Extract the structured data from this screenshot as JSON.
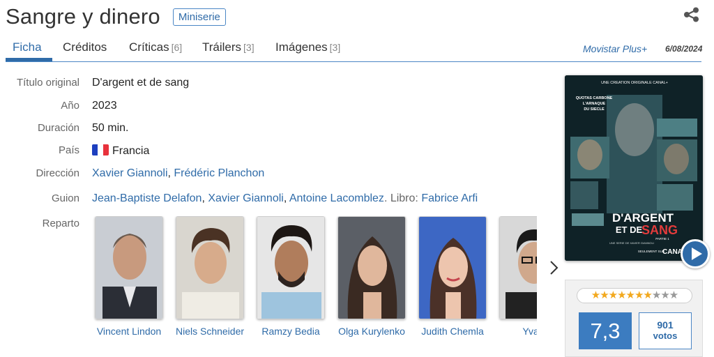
{
  "header": {
    "title": "Sangre y dinero",
    "type_badge": "Miniserie"
  },
  "icons": {
    "share": "share-icon",
    "next": "chevron-right-icon",
    "play": "play-icon",
    "flag": "france-flag-icon"
  },
  "tabs": [
    {
      "label": "Ficha",
      "count": ""
    },
    {
      "label": "Créditos",
      "count": ""
    },
    {
      "label": "Críticas",
      "count": "[6]"
    },
    {
      "label": "Tráilers",
      "count": "[3]"
    },
    {
      "label": "Imágenes",
      "count": "[3]"
    }
  ],
  "release": {
    "platform": "Movistar Plus+",
    "date": "6/08/2024"
  },
  "info": {
    "original_title": {
      "label": "Título original",
      "value": "D'argent et de sang"
    },
    "year": {
      "label": "Año",
      "value": "2023"
    },
    "duration": {
      "label": "Duración",
      "value": "50 min."
    },
    "country": {
      "label": "País",
      "value": "Francia"
    },
    "direction": {
      "label": "Dirección",
      "names": [
        "Xavier Giannoli",
        "Frédéric Planchon"
      ]
    },
    "script": {
      "label": "Guion",
      "names": [
        "Jean-Baptiste Delafon",
        "Xavier Giannoli",
        "Antoine Lacomblez"
      ],
      "book_label": "Libro:",
      "book_author": "Fabrice Arfi"
    },
    "cast_label": "Reparto"
  },
  "cast": [
    {
      "name": "Vincent Lindon"
    },
    {
      "name": "Niels Schneider"
    },
    {
      "name": "Ramzy Bedia"
    },
    {
      "name": "Olga Kurylenko"
    },
    {
      "name": "Judith Chemla"
    },
    {
      "name": "Yvan"
    }
  ],
  "poster": {
    "top_line": "UNE CREATION ORIGINALE CANAL+",
    "tagline": [
      "QUOTAS CARBONE",
      "L'ARNAQUE",
      "DU SIECLE"
    ],
    "title_line1": "D'ARGENT",
    "title_line2": "ET DE",
    "title_line3": "SANG",
    "part": "PARTIE 1",
    "credit": "UNE SERIE DE XAVIER GIANNOLI",
    "only_on": "SEULEMENT SUR",
    "channel": "CANAL"
  },
  "rating": {
    "stars_filled": 7,
    "stars_total": 10,
    "score": "7,3",
    "votes_count": "901",
    "votes_label": "votos"
  },
  "colors": {
    "accent": "#2f6ba8",
    "score_bg": "#3c7cc0",
    "star": "#f2a81d",
    "flag_blue": "#1d3fbf",
    "flag_red": "#e8323c"
  }
}
